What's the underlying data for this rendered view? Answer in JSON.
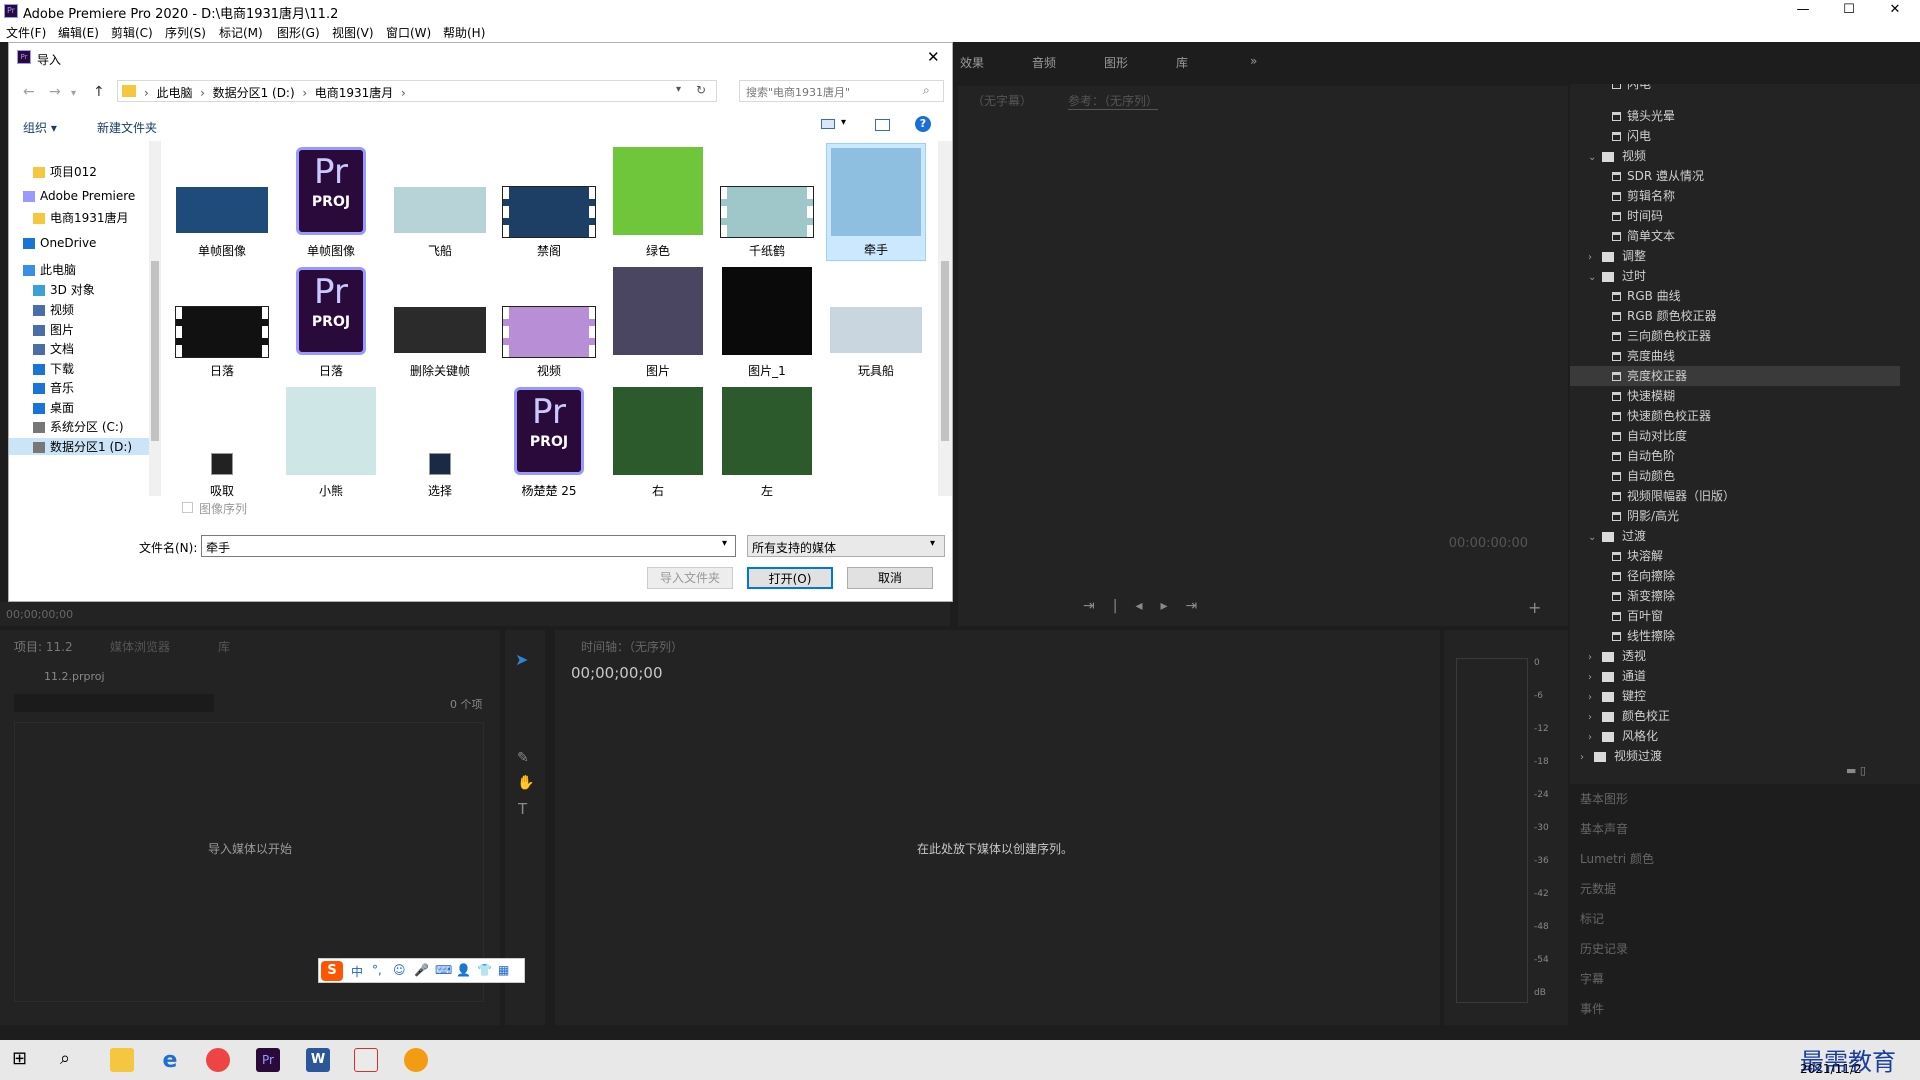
{
  "app": {
    "title": "Adobe Premiere Pro 2020 - D:\\电商1931唐月\\11.2",
    "logo": "Pr"
  },
  "window_controls": {
    "minimize": "—",
    "maximize": "☐",
    "close": "✕"
  },
  "menu": [
    "文件(F)",
    "编辑(E)",
    "剪辑(C)",
    "序列(S)",
    "标记(M)",
    "图形(G)",
    "视图(V)",
    "窗口(W)",
    "帮助(H)"
  ],
  "workspace_tabs": [
    "效果",
    "音频",
    "图形",
    "库"
  ],
  "workspace_more": "»",
  "program_monitor": {
    "source_label": "（无字幕）",
    "ref_label": "参考：（无序列）",
    "timecode": "00:00:00:00"
  },
  "source_timecode": "00;00;00;00",
  "project_panel": {
    "tabs": [
      "项目: 11.2",
      "媒体浏览器",
      "库"
    ],
    "file": "11.2.prproj",
    "count": "0 个项",
    "empty_msg": "导入媒体以开始"
  },
  "timeline_panel": {
    "title": "时间轴：（无序列）",
    "timecode": "00;00;00;00",
    "empty_msg": "在此处放下媒体以创建序列。"
  },
  "audio_meter_ticks": [
    "0",
    "-6",
    "-12",
    "-18",
    "-24",
    "-30",
    "-36",
    "-42",
    "-48",
    "-54",
    "dB"
  ],
  "effects_tree": [
    {
      "label": "闪电",
      "kind": "file",
      "indent": 2
    },
    {
      "label": "镜头光晕",
      "kind": "file",
      "indent": 2
    },
    {
      "label": "闪电",
      "kind": "file",
      "indent": 2
    },
    {
      "label": "视频",
      "kind": "folder",
      "indent": 1,
      "open": true
    },
    {
      "label": "SDR 遵从情况",
      "kind": "file",
      "indent": 2
    },
    {
      "label": "剪辑名称",
      "kind": "file",
      "indent": 2
    },
    {
      "label": "时间码",
      "kind": "file",
      "indent": 2
    },
    {
      "label": "简单文本",
      "kind": "file",
      "indent": 2
    },
    {
      "label": "调整",
      "kind": "folder",
      "indent": 1,
      "open": false
    },
    {
      "label": "过时",
      "kind": "folder",
      "indent": 1,
      "open": true
    },
    {
      "label": "RGB 曲线",
      "kind": "file",
      "indent": 2
    },
    {
      "label": "RGB 颜色校正器",
      "kind": "file",
      "indent": 2
    },
    {
      "label": "三向颜色校正器",
      "kind": "file",
      "indent": 2
    },
    {
      "label": "亮度曲线",
      "kind": "file",
      "indent": 2
    },
    {
      "label": "亮度校正器",
      "kind": "file",
      "indent": 2,
      "selected": true
    },
    {
      "label": "快速模糊",
      "kind": "file",
      "indent": 2
    },
    {
      "label": "快速颜色校正器",
      "kind": "file",
      "indent": 2
    },
    {
      "label": "自动对比度",
      "kind": "file",
      "indent": 2
    },
    {
      "label": "自动色阶",
      "kind": "file",
      "indent": 2
    },
    {
      "label": "自动颜色",
      "kind": "file",
      "indent": 2
    },
    {
      "label": "视频限幅器（旧版）",
      "kind": "file",
      "indent": 2
    },
    {
      "label": "阴影/高光",
      "kind": "file",
      "indent": 2
    },
    {
      "label": "过渡",
      "kind": "folder",
      "indent": 1,
      "open": true
    },
    {
      "label": "块溶解",
      "kind": "file",
      "indent": 2
    },
    {
      "label": "径向擦除",
      "kind": "file",
      "indent": 2
    },
    {
      "label": "渐变擦除",
      "kind": "file",
      "indent": 2
    },
    {
      "label": "百叶窗",
      "kind": "file",
      "indent": 2
    },
    {
      "label": "线性擦除",
      "kind": "file",
      "indent": 2
    },
    {
      "label": "透视",
      "kind": "folder",
      "indent": 1,
      "open": false
    },
    {
      "label": "通道",
      "kind": "folder",
      "indent": 1,
      "open": false
    },
    {
      "label": "键控",
      "kind": "folder",
      "indent": 1,
      "open": false
    },
    {
      "label": "颜色校正",
      "kind": "folder",
      "indent": 1,
      "open": false
    },
    {
      "label": "风格化",
      "kind": "folder",
      "indent": 1,
      "open": false
    },
    {
      "label": "视频过渡",
      "kind": "folder",
      "indent": 0,
      "open": false
    }
  ],
  "side_panels": [
    "基本图形",
    "基本声音",
    "Lumetri 颜色",
    "元数据",
    "标记",
    "历史记录",
    "字幕",
    "事件"
  ],
  "dialog": {
    "title": "导入",
    "close": "✕",
    "breadcrumb": [
      "此电脑",
      "数据分区1 (D:)",
      "电商1931唐月"
    ],
    "search_placeholder": "搜索\"电商1931唐月\"",
    "organize": "组织 ▾",
    "new_folder": "新建文件夹",
    "help": "?",
    "nav": [
      "项目012",
      "Adobe Premiere",
      "电商1931唐月",
      "OneDrive",
      "此电脑",
      "3D 对象",
      "视频",
      "图片",
      "文档",
      "下载",
      "音乐",
      "桌面",
      "系统分区 (C:)",
      "数据分区1 (D:)"
    ],
    "files": [
      {
        "name": "单帧图像",
        "type": "img",
        "color": "#1f4b7a"
      },
      {
        "name": "单帧图像",
        "type": "proj"
      },
      {
        "name": "飞船",
        "type": "img",
        "color": "#b7d3d8"
      },
      {
        "name": "禁阁",
        "type": "film",
        "color": "#1d3f66"
      },
      {
        "name": "绿色",
        "type": "img",
        "color": "#6fc63a"
      },
      {
        "name": "千纸鹤",
        "type": "film",
        "color": "#9fc7c9"
      },
      {
        "name": "牵手",
        "type": "img",
        "color": "#8fbfe0",
        "selected": true
      },
      {
        "name": "日落",
        "type": "film",
        "color": "#111"
      },
      {
        "name": "日落",
        "type": "proj"
      },
      {
        "name": "删除关键帧",
        "type": "img",
        "color": "#2b2b2b"
      },
      {
        "name": "视频",
        "type": "film",
        "color": "#b88fd6"
      },
      {
        "name": "图片",
        "type": "img",
        "color": "#4a4560"
      },
      {
        "name": "图片_1",
        "type": "img",
        "color": "#0a0a0a"
      },
      {
        "name": "玩具船",
        "type": "img",
        "color": "#c9d6e0"
      },
      {
        "name": "吸取",
        "type": "icon",
        "color": "#222"
      },
      {
        "name": "小熊",
        "type": "img",
        "color": "#cfe6e6"
      },
      {
        "name": "选择",
        "type": "icon",
        "color": "#1a2a44"
      },
      {
        "name": "杨楚楚 25",
        "type": "proj"
      },
      {
        "name": "右",
        "type": "img",
        "color": "#2c5a2c"
      },
      {
        "name": "左",
        "type": "img",
        "color": "#2c5a2c"
      }
    ],
    "image_sequence": "图像序列",
    "filename_label": "文件名(N):",
    "filename_value": "牵手",
    "filetype_value": "所有支持的媒体",
    "btn_import_folder": "导入文件夹",
    "btn_open": "打开(O)",
    "btn_cancel": "取消"
  },
  "ime_toolbar": [
    "中",
    "°,",
    "☺",
    "🎤",
    "⌨",
    "👤",
    "👕",
    "▦"
  ],
  "taskbar": {
    "time": "最需教育",
    "date": "2021/11/2"
  },
  "colors": {
    "accent": "#0078d7",
    "premiere_bg": "#1d1d1d",
    "panel": "#232323",
    "selected_effect": "#3a3a3a"
  }
}
